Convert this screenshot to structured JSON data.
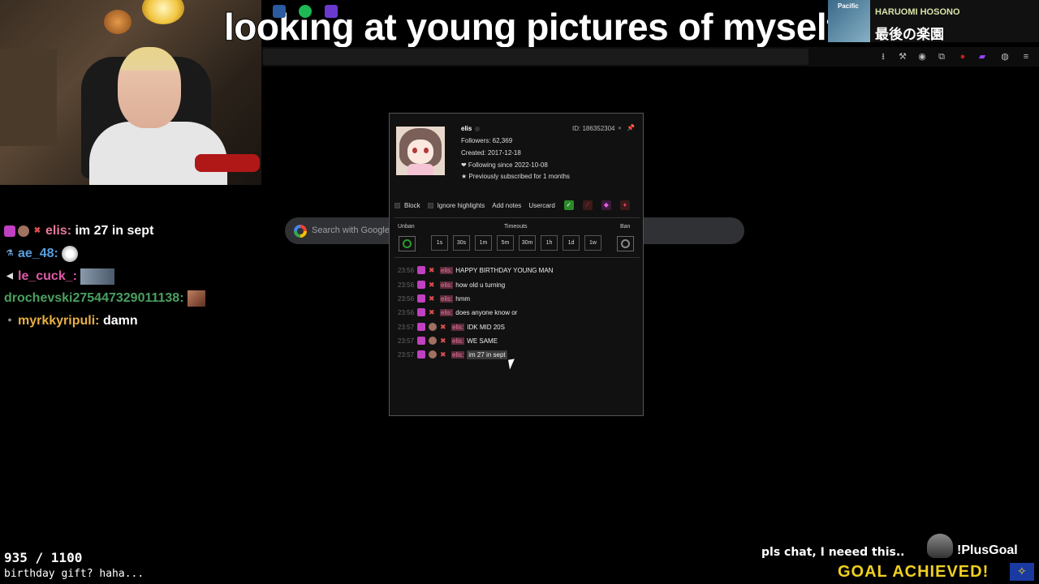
{
  "caption": "looking at young pictures of myself",
  "now_playing": {
    "album_text": "Pacific",
    "artist": "HARUOMI HOSONO",
    "song": "最後の楽園"
  },
  "browser": {
    "icons": [
      "download-icon",
      "wrench-icon",
      "account-icon",
      "extensions-icon",
      "record-icon",
      "twitch-icon",
      "gamepad-icon",
      "menu-icon"
    ],
    "search_placeholder": "Search with Google or"
  },
  "stream_chat": [
    {
      "user": "elis",
      "user_color": "#e87a9a",
      "text": "im 27 in sept"
    },
    {
      "user": "ae_48",
      "user_color": "#5aa0e0",
      "text": ""
    },
    {
      "user": "le_cuck_",
      "user_color": "#e05aa8",
      "text": ""
    },
    {
      "user": "drochevski275447329011138",
      "user_color": "#4aa060",
      "text": ""
    },
    {
      "user": "myrkkyripuli",
      "user_color": "#e8b040",
      "text": "damn"
    }
  ],
  "usercard": {
    "name": "elis",
    "id": "ID: 186352304",
    "followers": "Followers: 62,369",
    "created": "Created: 2017-12-18",
    "following": "❤ Following since 2022-10-08",
    "subscribed": "★ Previously subscribed for 1 months",
    "options": {
      "block": "Block",
      "ignore": "Ignore highlights",
      "add_notes": "Add notes",
      "usercard": "Usercard"
    },
    "unban_label": "Unban",
    "timeouts_label": "Timeouts",
    "ban_label": "Ban",
    "timeouts": [
      "1s",
      "30s",
      "1m",
      "5m",
      "30m",
      "1h",
      "1d",
      "1w"
    ],
    "messages": [
      {
        "time": "23:56",
        "user": "elis:",
        "text": "HAPPY BIRTHDAY YOUNG MAN",
        "extra_badge": false
      },
      {
        "time": "23:56",
        "user": "elis:",
        "text": "how old u turning",
        "extra_badge": false
      },
      {
        "time": "23:56",
        "user": "elis:",
        "text": "hmm",
        "extra_badge": false
      },
      {
        "time": "23:56",
        "user": "elis:",
        "text": "does anyone know or",
        "extra_badge": false
      },
      {
        "time": "23:57",
        "user": "elis:",
        "text": "IDK MID 20S",
        "extra_badge": true
      },
      {
        "time": "23:57",
        "user": "elis:",
        "text": "WE SAME",
        "extra_badge": true
      },
      {
        "time": "23:57",
        "user": "elis:",
        "text": "im 27 in sept",
        "extra_badge": true
      }
    ]
  },
  "goal": {
    "count": "935 / 1100",
    "subtitle": "birthday gift? haha..."
  },
  "plus_goal": {
    "text": "pls chat, I neeed this..",
    "command": "!PlusGoal",
    "achieved": "GOAL ACHIEVED!"
  },
  "colors": {
    "accent_pink": "#e87a9a",
    "goal_yellow": "#f0d020",
    "unban_green": "#2a8a2a"
  }
}
